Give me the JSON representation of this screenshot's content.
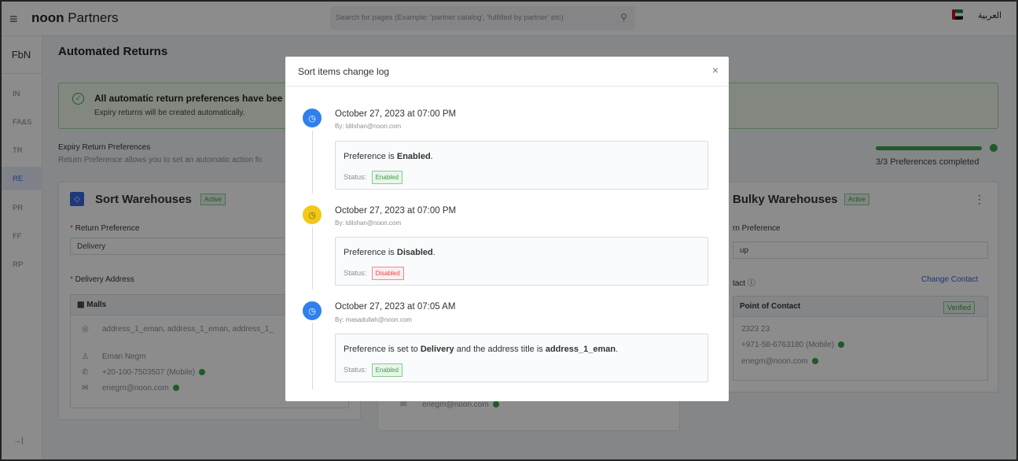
{
  "topbar": {
    "menu_icon": "hamburger-icon",
    "brand_bold": "noon",
    "brand_rest": " Partners",
    "search_placeholder": "Search for pages (Example: 'partner catalog', 'fulfilled by partner' etc)",
    "language": "العربية"
  },
  "sidebar": {
    "header": "FbN",
    "items": [
      {
        "label": "IN"
      },
      {
        "label": "FA&S"
      },
      {
        "label": "TR"
      },
      {
        "label": "RE",
        "active": true
      },
      {
        "label": "PR"
      },
      {
        "label": "FF"
      },
      {
        "label": "RP"
      }
    ],
    "collapse_icon": "→|"
  },
  "page": {
    "title": "Automated Returns",
    "success_title": "All automatic return preferences have bee",
    "success_sub": "Expiry returns will be created automatically.",
    "pref_title": "Expiry Return Preferences",
    "pref_sub": "Return Preference allows you to set an automatic action fo",
    "progress_fraction": 1.0,
    "progress_text": "3/3 Preferences completed"
  },
  "left_card": {
    "title": "Sort Warehouses",
    "badge": "Active",
    "return_pref_label": "Return Preference",
    "return_pref_value": "Delivery",
    "address_label": "Delivery Address",
    "box_title": "Malls",
    "address": "address_1_eman, address_1_eman, address_1_",
    "name": "Eman Negm",
    "phone": "+20-100-7503507 (Mobile)",
    "email": "enegm@noon.com"
  },
  "mid_card": {
    "email": "enegm@noon.com"
  },
  "right_card": {
    "title": "Bulky Warehouses",
    "badge": "Active",
    "return_pref_label": "rn Preference",
    "return_pref_value": "up",
    "contact_label": "tact",
    "change_contact": "Change Contact",
    "box_title": "Point of Contact",
    "verified": "Verified",
    "contact_name": "2323 23",
    "phone": "+971-58-6763180 (Mobile)",
    "email": "enegm@noon.com"
  },
  "modal": {
    "title": "Sort items change log",
    "close_icon": "×",
    "entries": [
      {
        "date": "October 27, 2023 at 07:00 PM",
        "by": "By: ldilshan@noon.com",
        "msg_pre": "Preference is ",
        "msg_bold": "Enabled",
        "msg_post": ".",
        "status_label": "Status:",
        "status": "Enabled",
        "dot_color": "#2f80ed"
      },
      {
        "date": "October 27, 2023 at 07:00 PM",
        "by": "By: ldilshan@noon.com",
        "msg_pre": "Preference is ",
        "msg_bold": "Disabled",
        "msg_post": ".",
        "status_label": "Status:",
        "status": "Disabled",
        "dot_color": "#f2c919"
      },
      {
        "date": "October 27, 2023 at 07:05 AM",
        "by": "By: masadullah@noon.com",
        "msg_pre": "Preference is set to ",
        "msg_bold": "Delivery",
        "msg_mid": " and the address title is ",
        "msg_bold2": "address_1_eman",
        "msg_post": ".",
        "status_label": "Status:",
        "status": "Enabled",
        "dot_color": "#2f80ed"
      }
    ]
  },
  "colors": {
    "accent": "#3866df",
    "success": "#3aa54b",
    "error": "#e04848"
  }
}
